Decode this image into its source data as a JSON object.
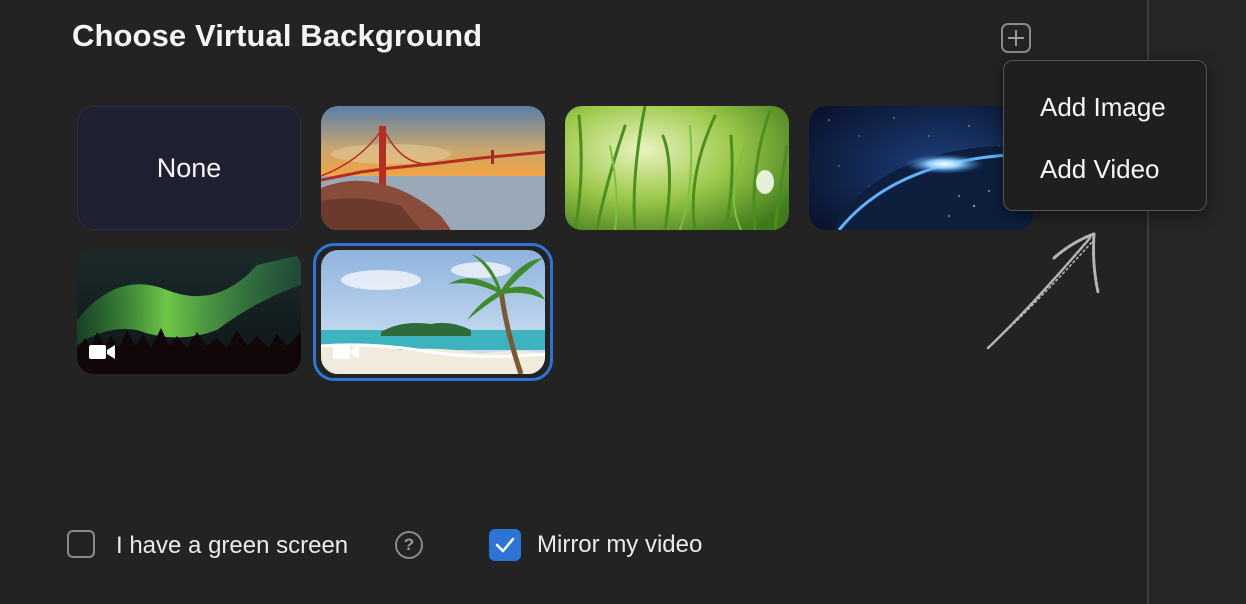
{
  "header": {
    "title": "Choose Virtual Background",
    "add_icon": "plus-icon"
  },
  "backgrounds": [
    {
      "id": "none",
      "label": "None",
      "kind": "none"
    },
    {
      "id": "golden-gate",
      "kind": "image"
    },
    {
      "id": "grass",
      "kind": "image"
    },
    {
      "id": "earth-space",
      "kind": "image"
    },
    {
      "id": "aurora",
      "kind": "video",
      "icon": "video-camera-icon"
    },
    {
      "id": "beach",
      "kind": "video",
      "icon": "video-camera-icon",
      "selected": true
    }
  ],
  "add_menu": {
    "items": [
      {
        "label": "Add Image"
      },
      {
        "label": "Add Video"
      }
    ]
  },
  "options": {
    "green_screen": {
      "label": "I have a green screen",
      "checked": false,
      "help_icon": "question-icon"
    },
    "mirror": {
      "label": "Mirror my video",
      "checked": true
    }
  },
  "colors": {
    "accent": "#2d74d6",
    "background": "#232323",
    "none_tile": "#1f2032"
  }
}
